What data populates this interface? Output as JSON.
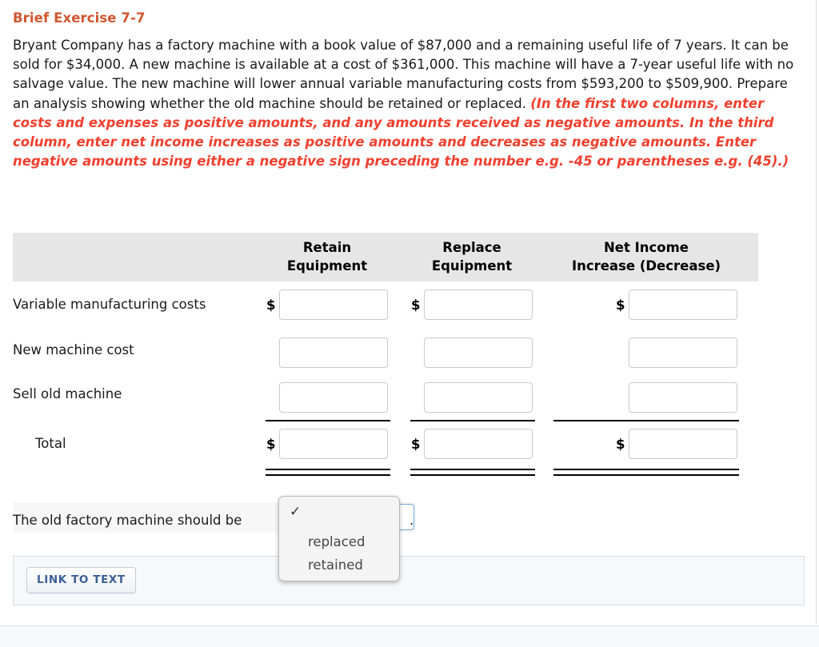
{
  "exercise": {
    "title": "Brief Exercise 7-7",
    "problem": "Bryant Company has a factory machine with a book value of $87,000 and a remaining useful life of 7 years. It can be sold for $34,000. A new machine is available at a cost of $361,000. This machine will have a 7-year useful life with no salvage value. The new machine will lower annual variable manufacturing costs from $593,200 to $509,900. Prepare an analysis showing whether the old machine should be retained or replaced. ",
    "instruction": "(In the first two columns, enter costs and expenses as positive amounts, and any amounts received as negative amounts.  In the third column, enter net income increases as positive amounts and decreases as negative amounts. Enter negative amounts using either a negative sign preceding the number e.g. -45 or parentheses e.g. (45).)"
  },
  "table": {
    "headers": [
      {
        "line1": "",
        "line2": ""
      },
      {
        "line1": "Retain",
        "line2": "Equipment"
      },
      {
        "line1": "Replace",
        "line2": "Equipment"
      },
      {
        "line1": "Net Income",
        "line2": "Increase (Decrease)"
      }
    ],
    "rows": [
      {
        "label": "Variable manufacturing costs",
        "indented": false,
        "show_dollar": true,
        "cells": [
          {
            "value": "",
            "placeholder": ""
          },
          {
            "value": "",
            "placeholder": ""
          },
          {
            "value": "",
            "placeholder": ""
          }
        ]
      },
      {
        "label": "New machine cost",
        "indented": false,
        "show_dollar": false,
        "cells": [
          {
            "value": "",
            "placeholder": ""
          },
          {
            "value": "",
            "placeholder": ""
          },
          {
            "value": "",
            "placeholder": ""
          }
        ]
      },
      {
        "label": "Sell old machine",
        "indented": false,
        "show_dollar": false,
        "cells": [
          {
            "value": "",
            "placeholder": ""
          },
          {
            "value": "",
            "placeholder": ""
          },
          {
            "value": "",
            "placeholder": ""
          }
        ]
      },
      {
        "label": "Total",
        "indented": true,
        "show_dollar": true,
        "cells": [
          {
            "value": "",
            "placeholder": ""
          },
          {
            "value": "",
            "placeholder": ""
          },
          {
            "value": "",
            "placeholder": ""
          }
        ]
      }
    ],
    "dollar_sign": "$"
  },
  "conclusion": {
    "prefix": "The old factory machine should be",
    "selected_value": "",
    "period": ".",
    "dropdown": {
      "open": true,
      "options": [
        {
          "label": "",
          "checked": true
        },
        {
          "label": "replaced",
          "checked": false
        },
        {
          "label": "retained",
          "checked": false
        }
      ],
      "check_glyph": "✓"
    }
  },
  "footer": {
    "link_to_text_label": "LINK TO TEXT"
  },
  "colors": {
    "title": "#d1562f",
    "instruction": "#f1402f",
    "header_band": "#e6e6e6",
    "panel": "#f5f9fb",
    "link_text": "#3a5f96"
  }
}
